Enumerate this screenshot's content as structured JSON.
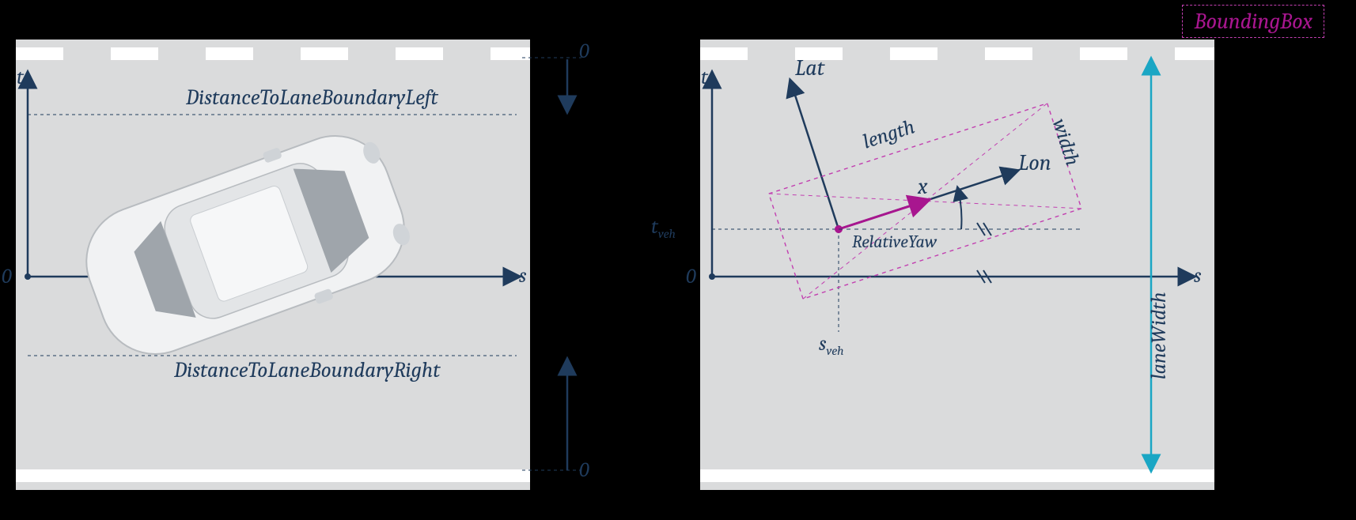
{
  "legend": "BoundingBox",
  "left": {
    "axis_t": "t",
    "axis_s": "s",
    "origin": "0",
    "distLeftLabel": "DistanceToLaneBoundaryLeft",
    "distRightLabel": "DistanceToLaneBoundaryRight",
    "zeroTop": "0",
    "zeroBottom": "0"
  },
  "right": {
    "axis_t": "t",
    "axis_s": "s",
    "origin": "0",
    "lat": "Lat",
    "lon": "Lon",
    "x": "x",
    "length": "length",
    "width": "width",
    "tveh": "t",
    "tveh_sub": "veh",
    "sveh": "s",
    "sveh_sub": "veh",
    "relYaw": "RelativeYaw",
    "laneWidth": "laneWidth"
  },
  "colors": {
    "navy": "#1f3b5c",
    "magenta": "#a8168f",
    "cyan": "#1aa6c4",
    "lane": "#dadbdc"
  }
}
